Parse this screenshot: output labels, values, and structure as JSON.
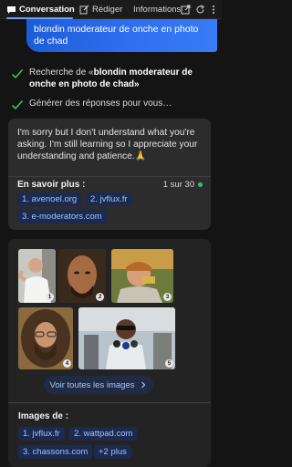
{
  "tabs": [
    {
      "label": "Conversation",
      "active": true,
      "icon": "chat-bubble-icon"
    },
    {
      "label": "Rédiger",
      "active": false,
      "icon": "compose-icon"
    },
    {
      "label": "Informations",
      "active": false,
      "icon": ""
    }
  ],
  "toolbar_icons": [
    "open-external-icon",
    "refresh-icon",
    "more-icon"
  ],
  "user_message": "blondin moderateur de onche en photo de chad",
  "progress": {
    "search_prefix": "Recherche de «",
    "search_query": "blondin moderateur de onche en photo de chad",
    "search_suffix": "»",
    "generate": "Générer des réponses pour vous…"
  },
  "answer": {
    "text": "I'm sorry but I don't understand what you're asking. I'm still learning so I appreciate your understanding and patience.",
    "emoji": "🙏",
    "learn_more_label": "En savoir plus :",
    "counter": "1 sur 30",
    "sources": [
      "1. avenoel.org",
      "2. jvflux.fr",
      "3. e-moderators.com"
    ]
  },
  "images": {
    "thumbnails": [
      {
        "index": "1",
        "alt": "Man in white t-shirt by window"
      },
      {
        "index": "2",
        "alt": "Bald man portrait"
      },
      {
        "index": "3",
        "alt": "Man drinking from cup"
      },
      {
        "index": "4",
        "alt": "Man with long curly hair and beard"
      },
      {
        "index": "5",
        "alt": "Man in sunglasses speaking to microphones"
      }
    ],
    "see_all_label": "Voir toutes les images",
    "images_of_label": "Images de :",
    "sources": [
      "1. jvflux.fr",
      "2. wattpad.com",
      "3. chassons.com",
      "+2 plus"
    ]
  },
  "colors": {
    "accent": "#2f6ff0",
    "check": "#3fbf6a",
    "chip_text": "#9ec3ff",
    "card_bg": "#2c2c2c"
  }
}
